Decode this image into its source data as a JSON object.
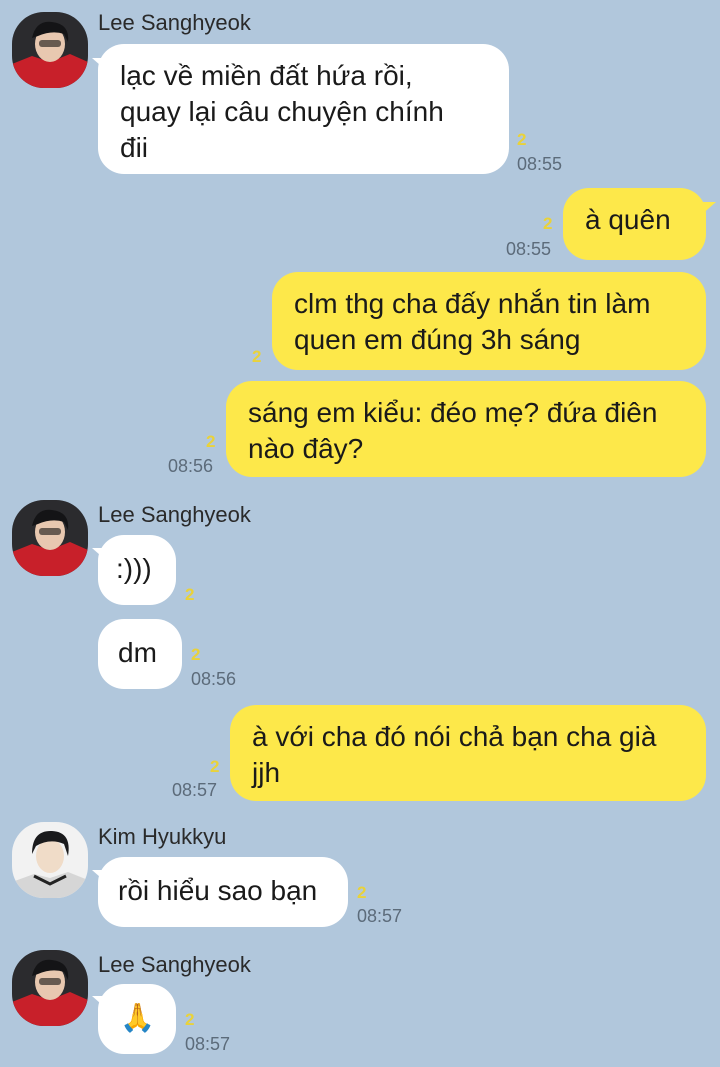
{
  "messages": [
    {
      "sender": "Lee Sanghyeok",
      "lines": [
        "lạc về miền đất hứa rồi,",
        "quay lại câu chuyện chính",
        "đii"
      ],
      "unread": "2",
      "time": "08:55"
    },
    {
      "lines": [
        "à quên"
      ],
      "unread": "2",
      "time": "08:55"
    },
    {
      "lines": [
        "clm thg cha đấy nhắn tin làm",
        "quen em đúng 3h sáng"
      ],
      "unread": "2"
    },
    {
      "lines": [
        "sáng em kiểu: đéo mẹ? đứa điên",
        "nào đây?"
      ],
      "unread": "2",
      "time": "08:56"
    },
    {
      "sender": "Lee Sanghyeok",
      "lines": [
        ":)))"
      ],
      "unread": "2"
    },
    {
      "lines": [
        "dm"
      ],
      "unread": "2",
      "time": "08:56"
    },
    {
      "lines": [
        "à với cha đó nói chả bạn cha già",
        "jjh"
      ],
      "unread": "2",
      "time": "08:57"
    },
    {
      "sender": "Kim Hyukkyu",
      "lines": [
        "rồi hiểu sao bạn"
      ],
      "unread": "2",
      "time": "08:57"
    },
    {
      "sender": "Lee Sanghyeok",
      "lines": [
        "🙏"
      ],
      "unread": "2",
      "time": "08:57"
    }
  ],
  "colors": {
    "background": "#b1c7dc",
    "incoming": "#ffffff",
    "outgoing": "#fde84a",
    "unread": "#e9d23a"
  },
  "icons": {
    "avatar_lee": "avatar-lee-sanghyeok",
    "avatar_kim": "avatar-kim-hyukkyu"
  }
}
